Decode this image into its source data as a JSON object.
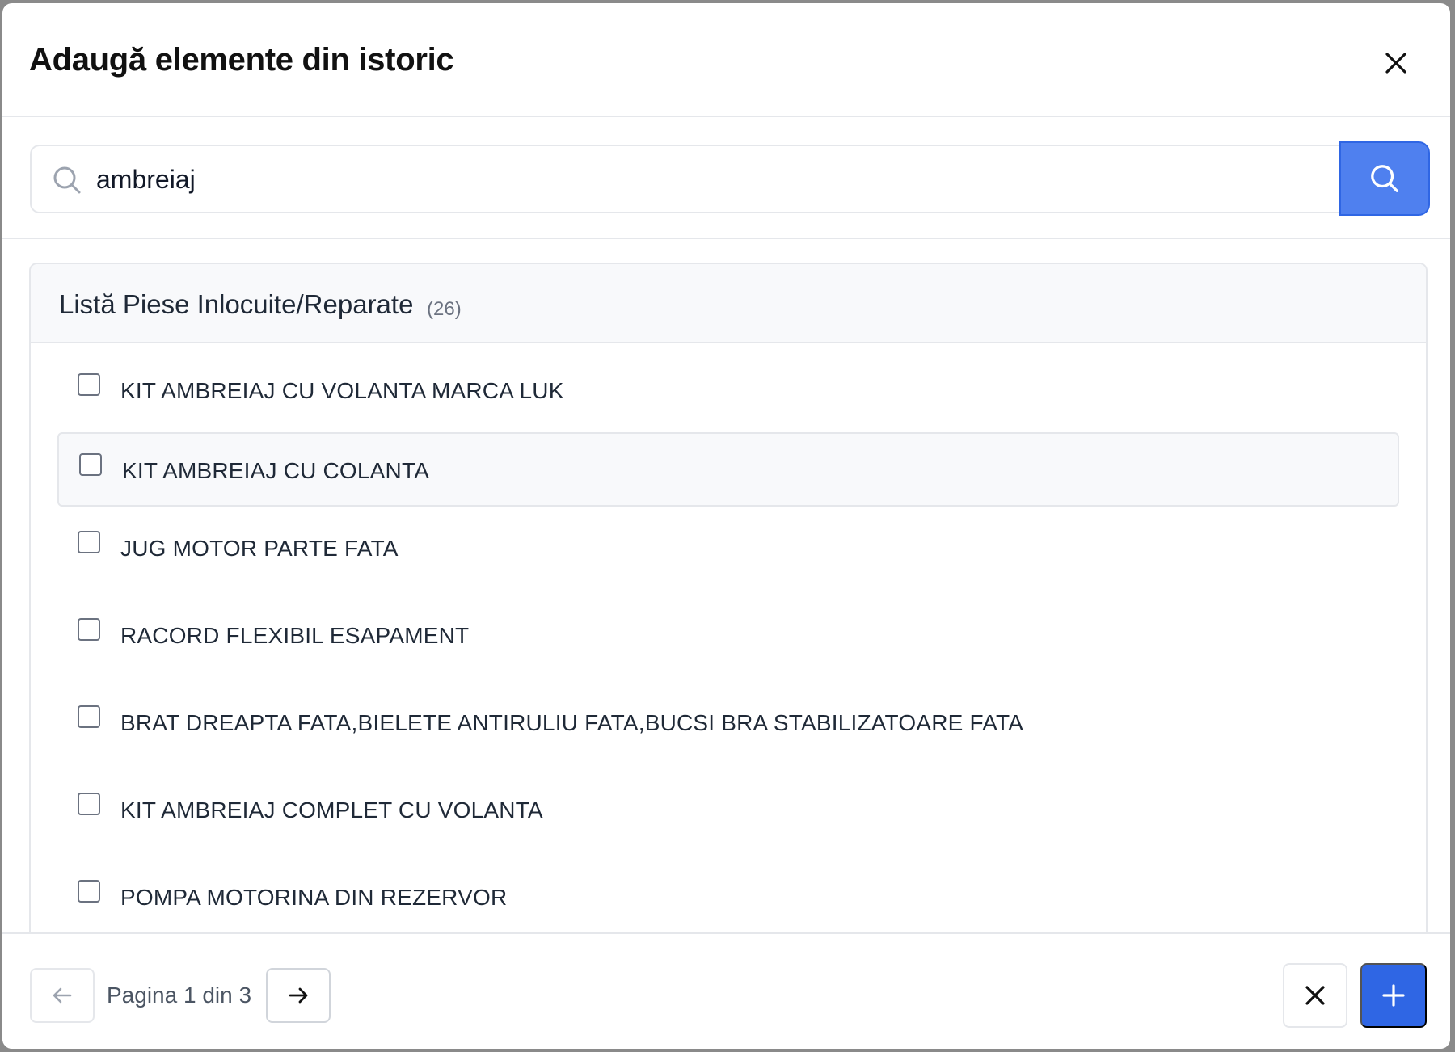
{
  "dialog": {
    "title": "Adaugă elemente din istoric",
    "close_icon": "close-icon"
  },
  "search": {
    "value": "ambreiaj",
    "placeholder": "",
    "search_icon": "search-icon",
    "button_icon": "search-icon"
  },
  "list": {
    "title": "Listă Piese Inlocuite/Reparate",
    "count": "(26)",
    "items": [
      {
        "label": "KIT AMBREIAJ CU VOLANTA MARCA LUK",
        "checked": false
      },
      {
        "label": "KIT AMBREIAJ CU COLANTA",
        "checked": false
      },
      {
        "label": "JUG MOTOR PARTE FATA",
        "checked": false
      },
      {
        "label": "RACORD FLEXIBIL ESAPAMENT",
        "checked": false
      },
      {
        "label": "BRAT DREAPTA FATA,BIELETE ANTIRULIU FATA,BUCSI BRA STABILIZATOARE FATA",
        "checked": false
      },
      {
        "label": "KIT AMBREIAJ COMPLET CU VOLANTA",
        "checked": false
      },
      {
        "label": "POMPA MOTORINA DIN REZERVOR",
        "checked": false
      }
    ]
  },
  "pagination": {
    "text": "Pagina 1 din 3",
    "prev_icon": "arrow-left-icon",
    "next_icon": "arrow-right-icon"
  },
  "actions": {
    "cancel_icon": "close-icon",
    "add_icon": "plus-icon"
  },
  "colors": {
    "primary": "#2f66e4",
    "search_button": "#4f80ef",
    "border": "#e5e7eb",
    "header_bg": "#f8f9fb"
  }
}
